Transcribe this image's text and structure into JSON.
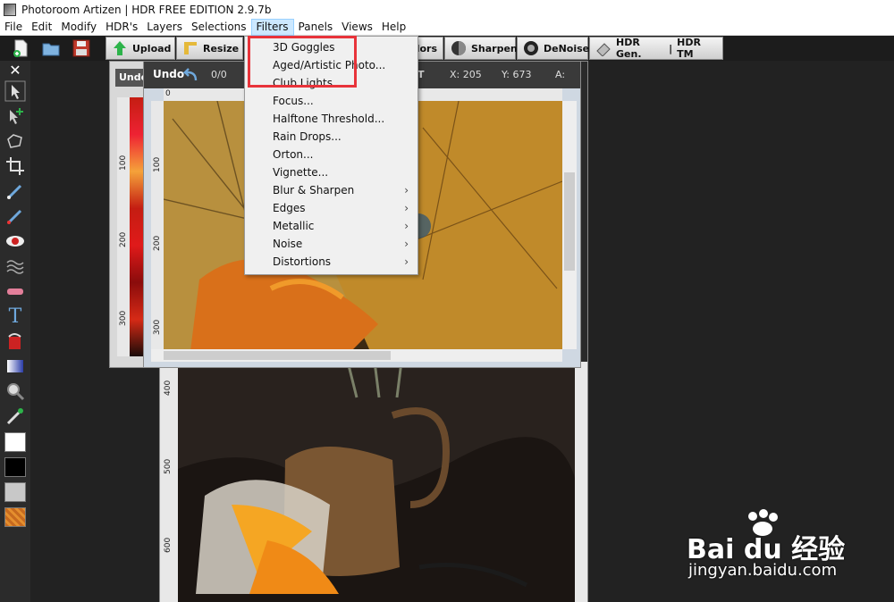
{
  "window": {
    "title": "Photoroom Artizen | HDR FREE EDITION 2.9.7b"
  },
  "menubar": {
    "items": [
      "File",
      "Edit",
      "Modify",
      "HDR's",
      "Layers",
      "Selections",
      "Filters",
      "Panels",
      "Views",
      "Help"
    ],
    "active": "Filters"
  },
  "toolbar": {
    "upload_label": "Upload",
    "resize_label": "Resize",
    "colors_label": "lors",
    "sharpen_label": "Sharpen",
    "denoise_label": "DeNoise",
    "hdrgen_label": "HDR Gen.",
    "hdrtm_label": "HDR TM"
  },
  "filters_menu": {
    "items": [
      {
        "label": "3D Goggles",
        "submenu": false
      },
      {
        "label": "Aged/Artistic Photo...",
        "submenu": false
      },
      {
        "label": "Club Lights",
        "submenu": false
      },
      {
        "label": "Focus...",
        "submenu": false
      },
      {
        "label": "Halftone Threshold...",
        "submenu": false
      },
      {
        "label": "Rain Drops...",
        "submenu": false
      },
      {
        "label": "Orton...",
        "submenu": false
      },
      {
        "label": "Vignette...",
        "submenu": false
      },
      {
        "label": "Blur & Sharpen",
        "submenu": true
      },
      {
        "label": "Edges",
        "submenu": true
      },
      {
        "label": "Metallic",
        "submenu": true
      },
      {
        "label": "Noise",
        "submenu": true
      },
      {
        "label": "Distortions",
        "submenu": true
      }
    ],
    "submenu_arrow": "›"
  },
  "image_window": {
    "undo_label": "Undo",
    "undo_count": "0/0",
    "x_readout": "X: 205",
    "y_readout": "Y: 673",
    "a_readout": "A:",
    "t_label": "T",
    "ruler_top_zero": "0",
    "ruler_left_labels": [
      "100",
      "200",
      "300"
    ],
    "back_window_undo": "Undo",
    "back_ruler_left_labels": [
      "100",
      "200",
      "300"
    ],
    "back_ruler_top_zero": "0",
    "bottom_ruler_labels": [
      "400",
      "500",
      "600"
    ]
  },
  "watermark": {
    "brand": "Bai du 经验",
    "url": "jingyan.baidu.com"
  },
  "colors": {
    "highlight": "#e8333a",
    "menu_active": "#cce8ff"
  }
}
